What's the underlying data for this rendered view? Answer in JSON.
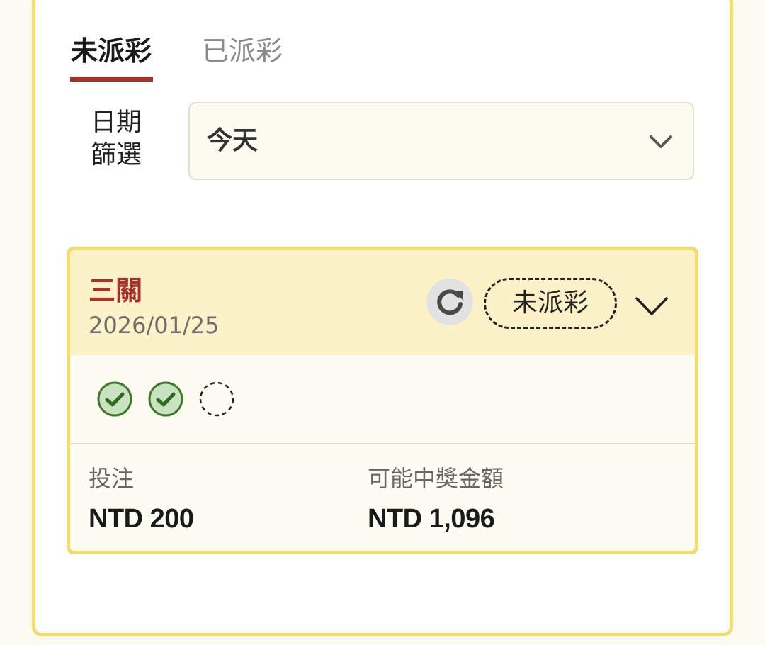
{
  "tabs": [
    {
      "label": "未派彩",
      "active": true
    },
    {
      "label": "已派彩",
      "active": false
    }
  ],
  "filter": {
    "label": "日期篩選",
    "label_line1": "日期",
    "label_line2": "篩選",
    "selected": "今天"
  },
  "bet_card": {
    "type": "三關",
    "date": "2026/01/25",
    "status": "未派彩",
    "legs": [
      {
        "state": "won",
        "icon": "check-circle-icon"
      },
      {
        "state": "won",
        "icon": "check-circle-icon"
      },
      {
        "state": "pending",
        "icon": "dashed-circle-icon"
      }
    ],
    "stake_label": "投注",
    "stake_value": "NTD 200",
    "payout_label": "可能中獎金額",
    "payout_value": "NTD 1,096"
  },
  "colors": {
    "accent_red": "#a8322a",
    "card_border": "#f2dc6a",
    "card_header_bg": "#fcf2c8",
    "check_green": "#3e7a2a",
    "check_fill": "#c9e2bf"
  }
}
